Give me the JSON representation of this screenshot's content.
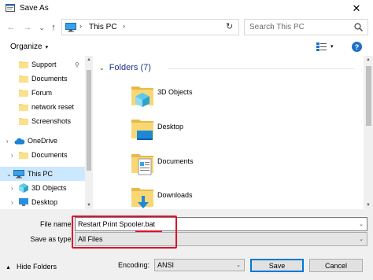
{
  "window": {
    "title": "Save As",
    "close_glyph": "✕"
  },
  "nav": {
    "back_glyph": "←",
    "forward_glyph": "→",
    "recent_glyph": "⌄",
    "up_glyph": "↑"
  },
  "address": {
    "crumbs": [
      "This PC"
    ],
    "sep_glyph": "›",
    "dropdown_glyph": "⌄",
    "refresh_glyph": "↻"
  },
  "search": {
    "placeholder": "Search This PC"
  },
  "toolbar": {
    "organize_label": "Organize",
    "organize_arrow": "▾",
    "view_dropdown": "▾",
    "help_glyph": "?"
  },
  "sidebar": {
    "items": [
      {
        "label": "Support",
        "icon": "folder-icon",
        "pinned": true
      },
      {
        "label": "Documents",
        "icon": "folder-icon"
      },
      {
        "label": "Forum",
        "icon": "folder-icon"
      },
      {
        "label": "network reset",
        "icon": "folder-icon"
      },
      {
        "label": "Screenshots",
        "icon": "folder-icon"
      },
      {
        "label": "OneDrive",
        "icon": "cloud-icon",
        "expand": "›"
      },
      {
        "label": "Documents",
        "icon": "folder-icon",
        "expand": "›"
      },
      {
        "label": "This PC",
        "icon": "computer-icon",
        "expand": "⌄",
        "selected": true
      },
      {
        "label": "3D Objects",
        "icon": "cube-icon",
        "expand": "›"
      },
      {
        "label": "Desktop",
        "icon": "desktop-icon",
        "expand": "›"
      }
    ],
    "pin_glyph": "📌"
  },
  "content": {
    "group_title": "Folders (7)",
    "group_chev": "⌄",
    "folders": [
      {
        "label": "3D Objects",
        "icon": "cube-folder-icon"
      },
      {
        "label": "Desktop",
        "icon": "desktop-folder-icon"
      },
      {
        "label": "Documents",
        "icon": "documents-folder-icon"
      },
      {
        "label": "Downloads",
        "icon": "downloads-folder-icon"
      }
    ]
  },
  "scroll": {
    "up_glyph": "▲",
    "down_glyph": "▼"
  },
  "form": {
    "filename_label": "File name:",
    "filename_value": "Restart Print Spooler.bat",
    "filetype_label": "Save as type:",
    "filetype_value": "All Files",
    "dropdown_glyph": "⌄",
    "hide_folders_label": "Hide Folders",
    "hide_folders_arrow": "▲",
    "encoding_label": "Encoding:",
    "encoding_value": "ANSI",
    "save_label": "Save",
    "cancel_label": "Cancel"
  },
  "colors": {
    "accent": "#0078d7",
    "selection": "#cce8ff",
    "highlight": "#e0112a",
    "group_title": "#1e3287"
  }
}
